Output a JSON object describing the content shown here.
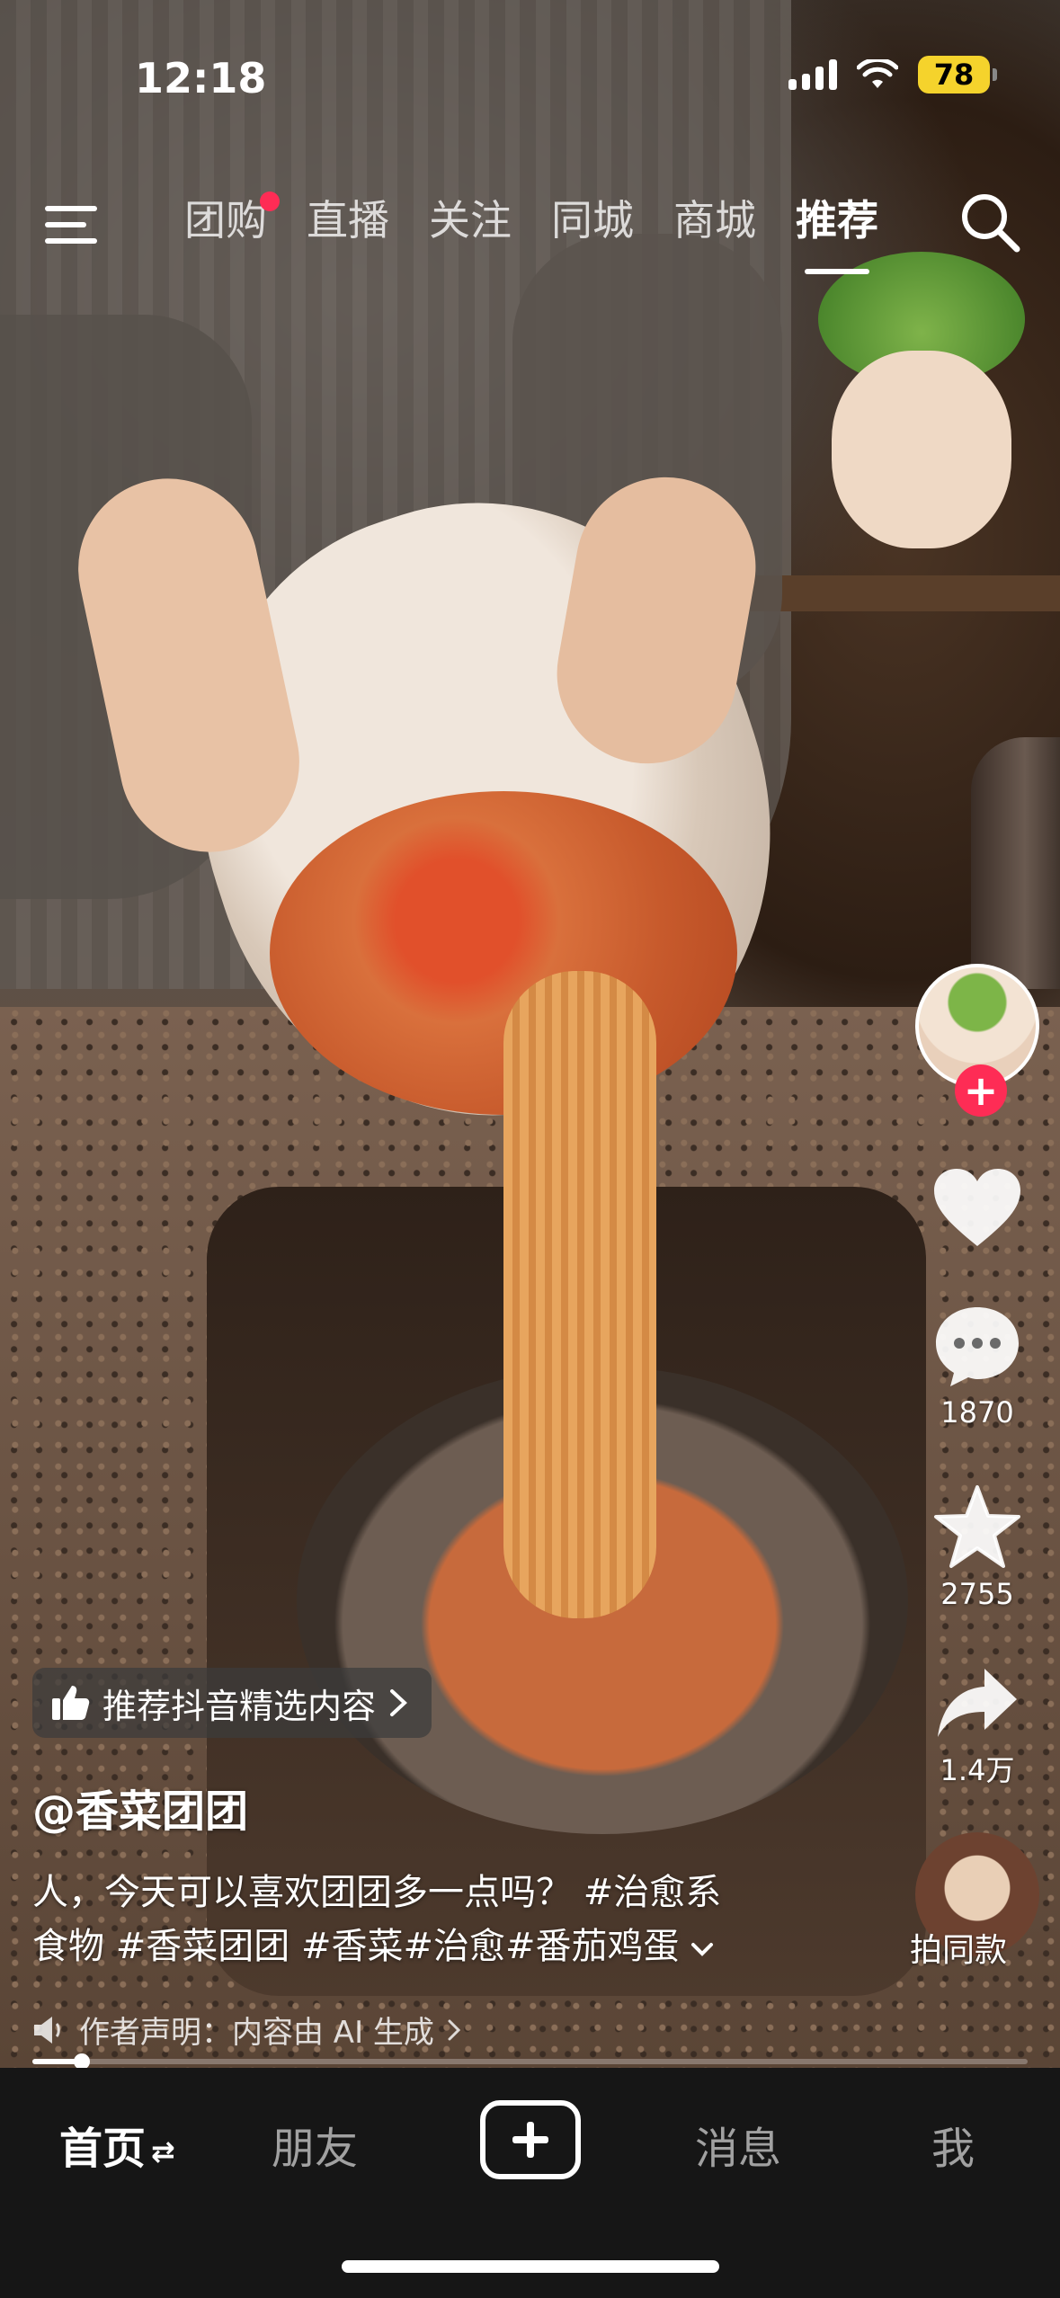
{
  "status_bar": {
    "time": "12:18",
    "battery": "78"
  },
  "top_nav": {
    "tabs": [
      {
        "label": "团购",
        "has_dot": true
      },
      {
        "label": "直播"
      },
      {
        "label": "关注"
      },
      {
        "label": "同城"
      },
      {
        "label": "商城"
      },
      {
        "label": "推荐",
        "active": true
      }
    ],
    "menu_icon": "hamburger-menu-icon",
    "search_icon": "search-icon"
  },
  "rail": {
    "follow_icon": "plus-icon",
    "like_icon": "heart-icon",
    "comment_icon": "comment-bubble-icon",
    "comment_count": "1870",
    "favorite_icon": "star-icon",
    "favorite_count": "2755",
    "share_icon": "share-arrow-icon",
    "share_count": "1.4万",
    "same_style_label": "拍同款"
  },
  "video": {
    "recommend_chip": "推荐抖音精选内容",
    "author": "@香菜团团",
    "description_line1": "人，今天可以喜欢团团多一点吗？ #治愈系",
    "description_line2": "食物 #香菜团团 #香菜#治愈#番茄鸡蛋",
    "declaration": "作者声明：内容由 AI 生成",
    "progress": 0.05
  },
  "bottom_nav": {
    "home": "首页",
    "friends": "朋友",
    "inbox": "消息",
    "me": "我",
    "create_icon": "plus-icon"
  },
  "colors": {
    "accent": "#fe2c55",
    "battery": "#f5d32c",
    "bottom_bar": "#161616"
  }
}
